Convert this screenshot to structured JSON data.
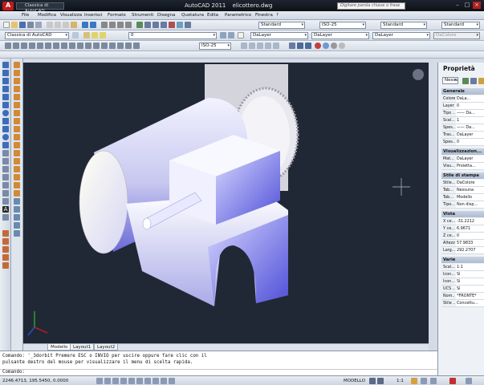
{
  "app": {
    "name": "AutoCAD 2011",
    "file": "elicottero.dwg",
    "workspace": "Classica di AutoCAD",
    "search_placeholder": "Digitare parola chiave o frase"
  },
  "menu": [
    "File",
    "Modifica",
    "Visualizza",
    "Inserisci",
    "Formato",
    "Strumenti",
    "Disegna",
    "Quotatura",
    "Edita",
    "Parametrico",
    "Finestra",
    "?"
  ],
  "toolbar2": {
    "workspace": "Classica di AutoCAD",
    "layer_value": "0",
    "text_style": "Standard",
    "dim_style": "ISO-25",
    "table_style": "Standard",
    "multileader_style": "Standard",
    "color": "DaLayer",
    "linetype": "DaLayer",
    "lineweight": "DaLayer",
    "plotstyle": "DaColore"
  },
  "toolbar3": {
    "dim_scale": "ISO-25"
  },
  "tabs": [
    "Modello",
    "Layout1",
    "Layout2"
  ],
  "command": {
    "line1": "Comando: '_3dorbit Premere ESC o INVIO per uscire oppure fare clic con il",
    "line2": "pulsante destro del mouse per visualizzare il menu di scelta rapida.",
    "prompt": "Comando:"
  },
  "status": {
    "coords": "2246.4713, 195.5450, 0.0000",
    "model": "MODELLO",
    "scale": "1:1"
  },
  "properties": {
    "title": "Proprietà",
    "selection": "Nessu",
    "sections": [
      {
        "name": "Generale",
        "rows": [
          [
            "Colore",
            "DaLa..."
          ],
          [
            "Layer",
            "0"
          ],
          [
            "Tipo ...",
            "—— Da..."
          ],
          [
            "Scal...",
            "1"
          ],
          [
            "Spes...",
            "—— Da..."
          ],
          [
            "Tras...",
            "DaLayer"
          ],
          [
            "Spes...",
            "0"
          ]
        ]
      },
      {
        "name": "Visualizzazion...",
        "rows": [
          [
            "Mat...",
            "DaLayer"
          ],
          [
            "Visu...",
            "Proietta..."
          ]
        ]
      },
      {
        "name": "Stile di stampa",
        "rows": [
          [
            "Stile...",
            "DaColore"
          ],
          [
            "Tab...",
            "Nessuna"
          ],
          [
            "Tab...",
            "Modello"
          ],
          [
            "Tipo...",
            "Non disp..."
          ]
        ]
      },
      {
        "name": "Vista",
        "rows": [
          [
            "X ce...",
            "-31.2212"
          ],
          [
            "Y ce...",
            "6.9671"
          ],
          [
            "Z ce...",
            "0"
          ],
          [
            "Altezza",
            "57.9833"
          ],
          [
            "Larg...",
            "292.2707"
          ]
        ]
      },
      {
        "name": "Varie",
        "rows": [
          [
            "Scal...",
            "1:1"
          ],
          [
            "Icon...",
            "Sì"
          ],
          [
            "Icon...",
            "Sì"
          ],
          [
            "UCS ...",
            "Sì"
          ],
          [
            "Nom...",
            "*FRONTE*"
          ],
          [
            "Stile ...",
            "Concettu..."
          ]
        ]
      }
    ]
  }
}
